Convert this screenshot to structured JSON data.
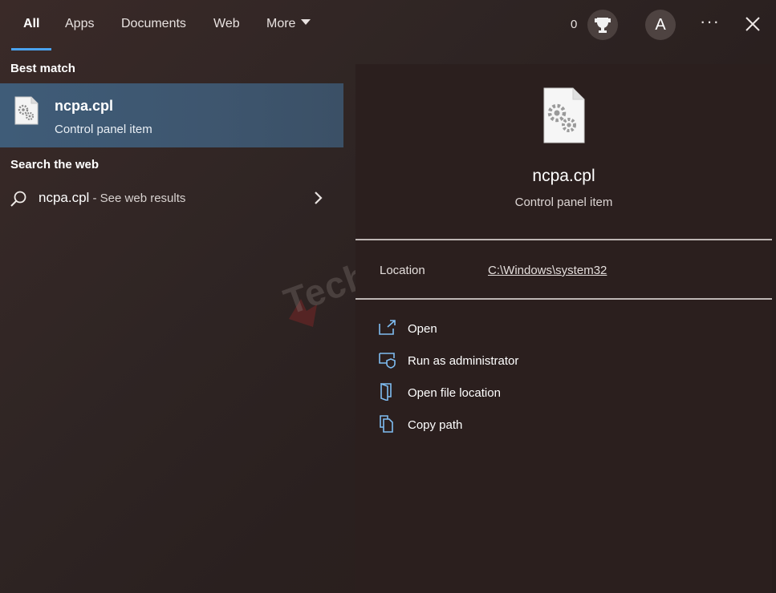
{
  "tabs": [
    {
      "label": "All"
    },
    {
      "label": "Apps"
    },
    {
      "label": "Documents"
    },
    {
      "label": "Web"
    },
    {
      "label": "More"
    }
  ],
  "header": {
    "points": "0",
    "avatar_letter": "A",
    "more_options": "···"
  },
  "best_match": {
    "section_title": "Best match",
    "name": "ncpa.cpl",
    "type": "Control panel item"
  },
  "web": {
    "section_title": "Search the web",
    "query": "ncpa.cpl",
    "suffix": " - See web results"
  },
  "detail": {
    "name": "ncpa.cpl",
    "type": "Control panel item",
    "location_label": "Location",
    "location_value": "C:\\Windows\\system32",
    "actions": [
      {
        "label": "Open",
        "icon": "open-icon"
      },
      {
        "label": "Run as administrator",
        "icon": "run-as-admin-icon"
      },
      {
        "label": "Open file location",
        "icon": "folder-location-icon"
      },
      {
        "label": "Copy path",
        "icon": "copy-icon"
      }
    ]
  },
  "watermark": {
    "text": "Techdim"
  },
  "colors": {
    "accent": "#4aa3ef",
    "selected": "#3f5c78"
  }
}
